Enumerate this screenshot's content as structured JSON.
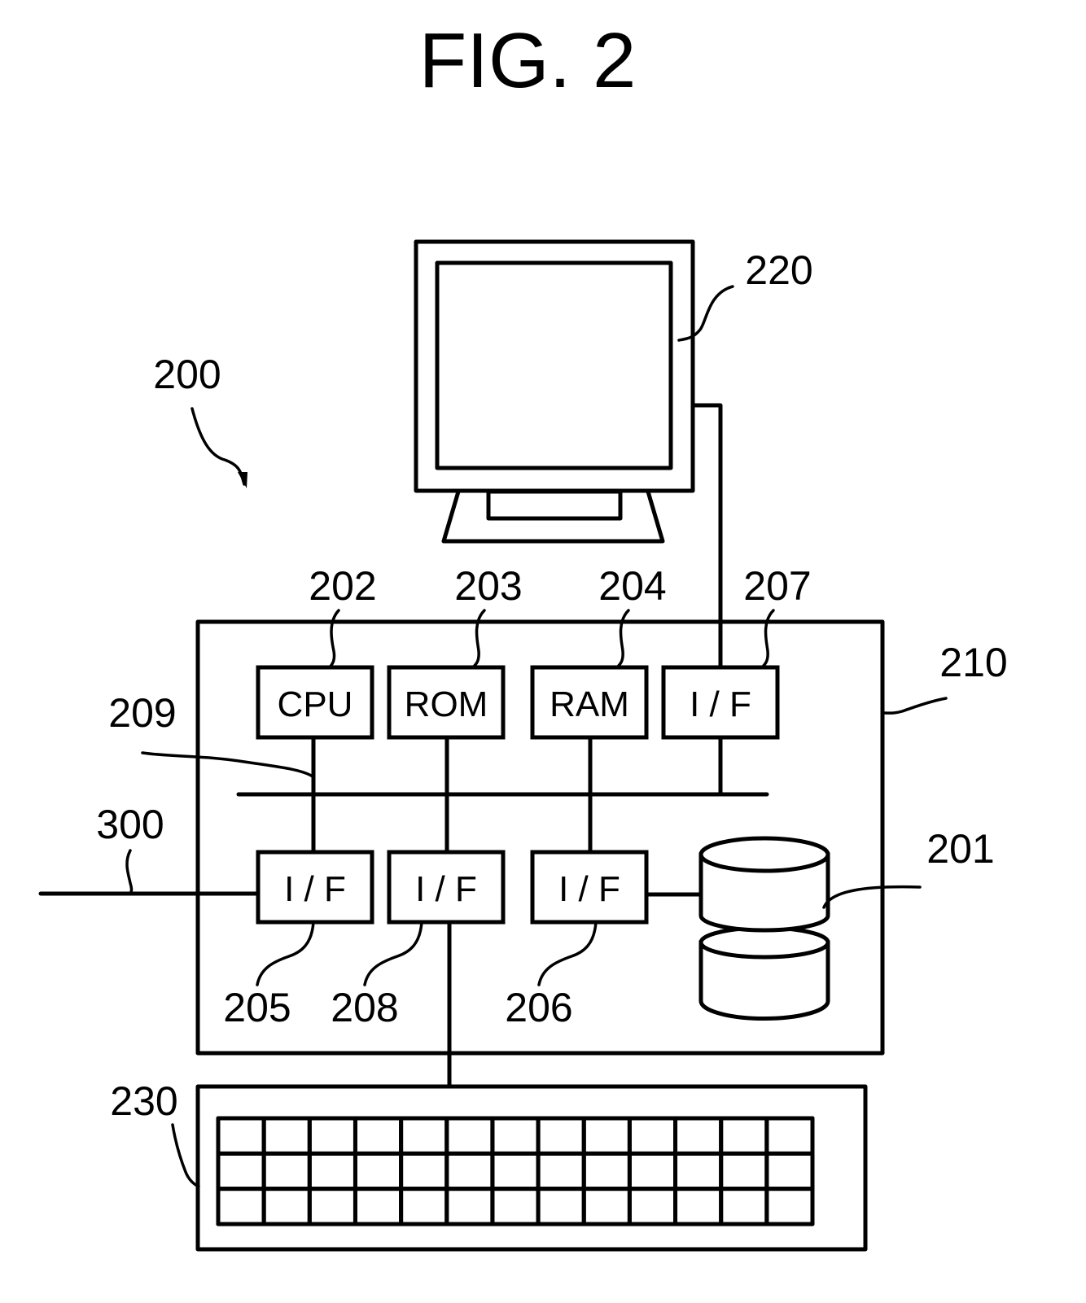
{
  "figure": {
    "title": "FIG. 2",
    "system_ref": "200"
  },
  "monitor": {
    "ref": "220"
  },
  "computer": {
    "ref": "210"
  },
  "bus": {
    "ref": "209"
  },
  "network": {
    "ref": "300"
  },
  "storage": {
    "ref": "201"
  },
  "keyboard": {
    "ref": "230",
    "rows": 3,
    "cols": 13
  },
  "components": {
    "cpu": {
      "label": "CPU",
      "ref": "202"
    },
    "rom": {
      "label": "ROM",
      "ref": "203"
    },
    "ram": {
      "label": "RAM",
      "ref": "204"
    },
    "if_display": {
      "label": "I / F",
      "ref": "207"
    },
    "if_network": {
      "label": "I / F",
      "ref": "205"
    },
    "if_input": {
      "label": "I / F",
      "ref": "208"
    },
    "if_storage": {
      "label": "I / F",
      "ref": "206"
    }
  },
  "colors": {
    "ink": "#000000",
    "paper": "#ffffff"
  }
}
